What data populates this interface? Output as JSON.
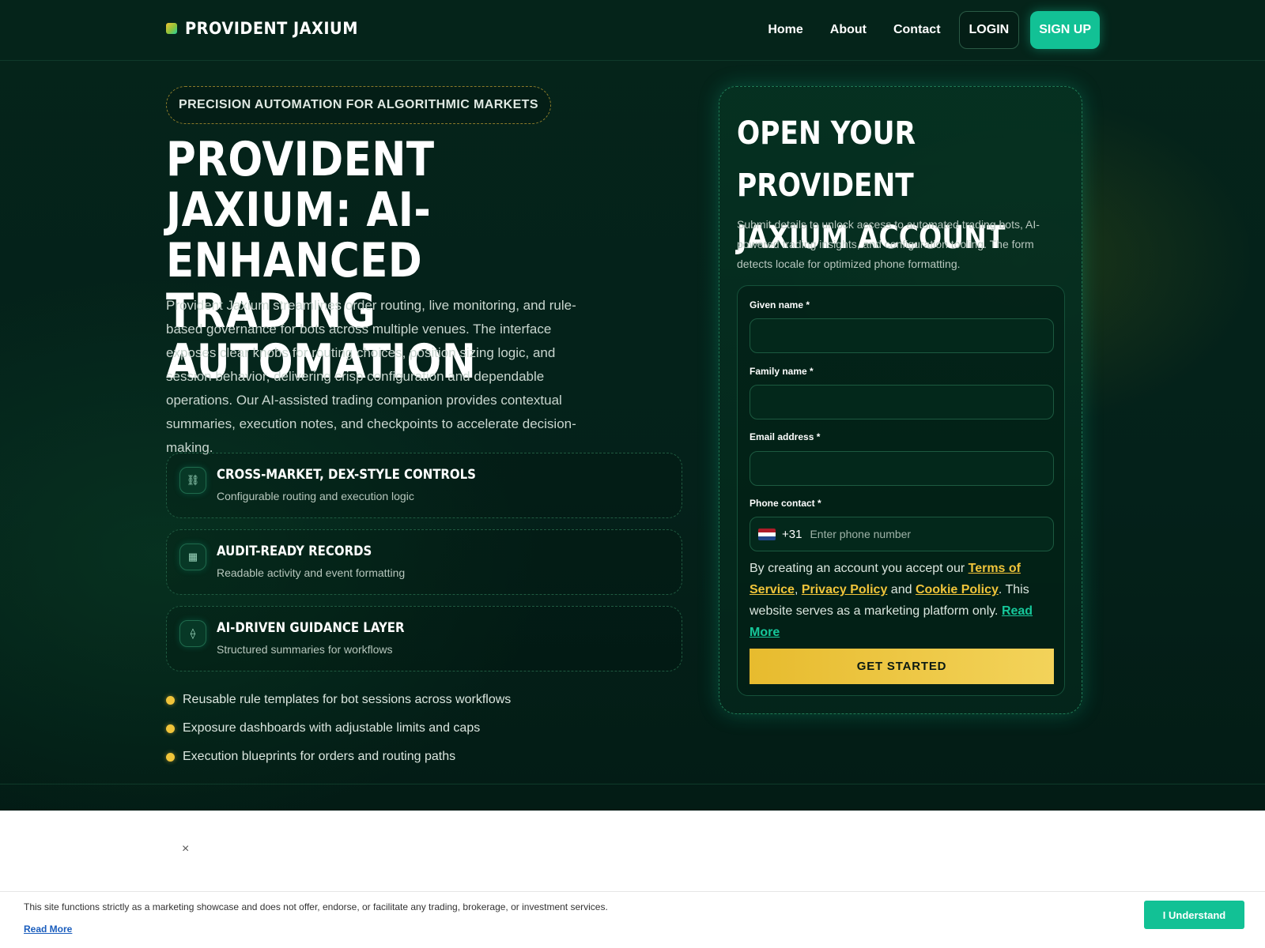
{
  "header": {
    "brand": "PROVIDENT JAXIUM",
    "nav": [
      {
        "label": "Home"
      },
      {
        "label": "About"
      },
      {
        "label": "Contact"
      }
    ],
    "login_label": "LOGIN",
    "signup_label": "SIGN UP"
  },
  "hero": {
    "badge": "PRECISION AUTOMATION FOR ALGORITHMIC MARKETS",
    "title": "PROVIDENT JAXIUM: AI-ENHANCED TRADING AUTOMATION",
    "description": "Provident Jaxium streamlines order routing, live monitoring, and rule-based governance for bots across multiple venues. The interface exposes clear knobs for routing choices, position sizing logic, and session behavior, delivering crisp configuration and dependable operations. Our AI-assisted trading companion provides contextual summaries, execution notes, and checkpoints to accelerate decision-making.",
    "features": [
      {
        "icon": "link-icon",
        "glyph": "⛓",
        "title": "CROSS-MARKET, DEX-STYLE CONTROLS",
        "subtitle": "Configurable routing and execution logic"
      },
      {
        "icon": "grid-icon",
        "glyph": "▦",
        "title": "AUDIT-READY RECORDS",
        "subtitle": "Readable activity and event formatting"
      },
      {
        "icon": "ethereum-icon",
        "glyph": "⟠",
        "title": "AI-DRIVEN GUIDANCE LAYER",
        "subtitle": "Structured summaries for workflows"
      }
    ],
    "bullets": [
      "Reusable rule templates for bot sessions across workflows",
      "Exposure dashboards with adjustable limits and caps",
      "Execution blueprints for orders and routing paths"
    ]
  },
  "signup": {
    "title": "OPEN YOUR PROVIDENT JAXIUM ACCOUNT",
    "description": "Submit details to unlock access to automated trading bots, AI-powered trading insights, and configuration tooling. The form detects locale for optimized phone formatting.",
    "fields": {
      "given_name": {
        "label": "Given name *",
        "value": ""
      },
      "family_name": {
        "label": "Family name *",
        "value": ""
      },
      "email": {
        "label": "Email address *",
        "value": ""
      },
      "phone": {
        "label": "Phone contact *",
        "dial_code": "+31",
        "placeholder": "Enter phone number"
      }
    },
    "terms": {
      "prefix": "By creating an account you accept our ",
      "terms_link": "Terms of Service",
      "comma": ", ",
      "privacy_link": "Privacy Policy",
      "and": " and ",
      "cookie_link": "Cookie Policy",
      "suffix": ". This website serves as a marketing platform only. ",
      "read_more": "Read More"
    },
    "submit_label": "GET STARTED"
  },
  "popup": {
    "close": "×"
  },
  "cookie": {
    "text": "This site functions strictly as a marketing showcase and does not offer, endorse, or facilitate any trading, brokerage, or investment services.",
    "read_more": "Read More",
    "button": "I Understand"
  },
  "colors": {
    "accent_teal": "#12c195",
    "accent_gold": "#f0c43a",
    "background": "#04211a"
  }
}
